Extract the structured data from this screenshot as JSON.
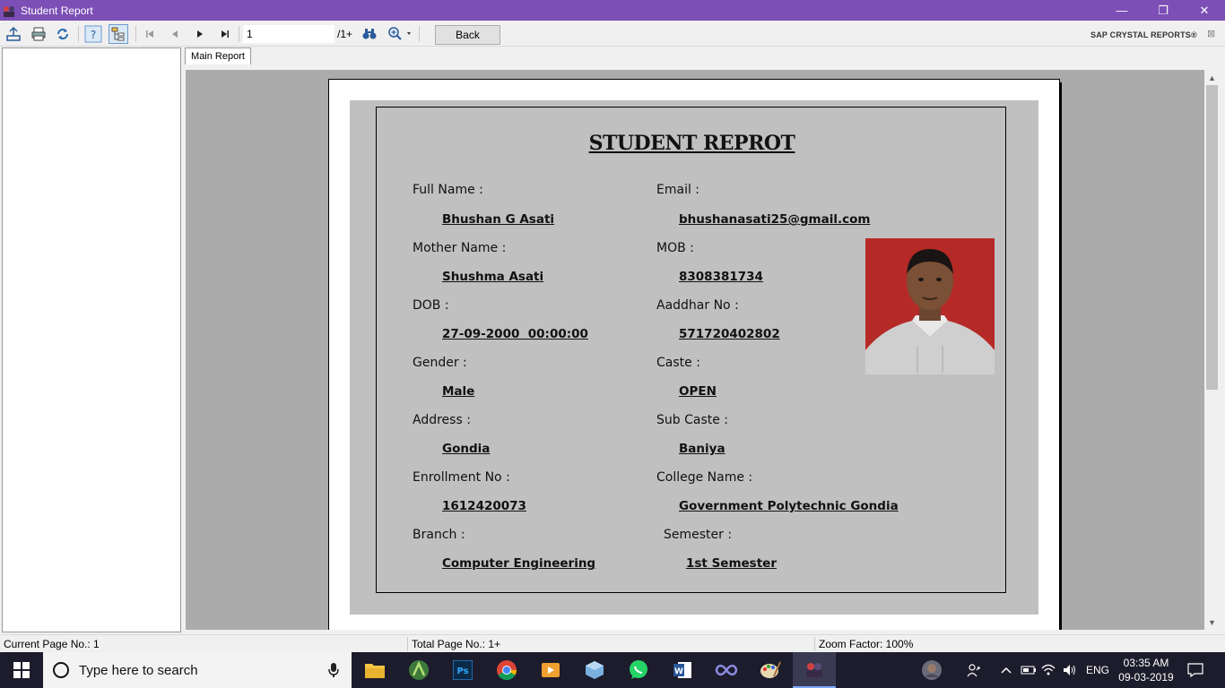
{
  "window": {
    "title": "Student Report",
    "controls": {
      "minimize": "—",
      "restore": "❐",
      "close": "✕"
    }
  },
  "toolbar": {
    "page_value": "1",
    "page_total": "/1+",
    "back_label": "Back",
    "brand": "SAP CRYSTAL REPORTS®",
    "brand_close": "⊠"
  },
  "tabs": {
    "main": "Main Report"
  },
  "report": {
    "title": "STUDENT REPROT",
    "fields": {
      "full_name_label": "Full Name :",
      "full_name": "Bhushan G Asati",
      "email_label": "Email :",
      "email": "bhushanasati25@gmail.com",
      "mother_label": "Mother Name :",
      "mother": "Shushma Asati",
      "mob_label": "MOB :",
      "mob": "8308381734",
      "dob_label": "DOB :",
      "dob": "27-09-2000  00:00:00",
      "aadhar_label": "Aaddhar No :",
      "aadhar": "571720402802",
      "gender_label": "Gender :",
      "gender": "Male",
      "caste_label": "Caste :",
      "caste": "OPEN",
      "address_label": "Address :",
      "address": "Gondia",
      "subcaste_label": "Sub Caste :",
      "subcaste": "Baniya",
      "enroll_label": "Enrollment No :",
      "enroll": "1612420073",
      "college_label": "College Name :",
      "college": "Government Polytechnic Gondia",
      "branch_label": "Branch :",
      "branch": "Computer Engineering",
      "semester_label": "Semester :",
      "semester": "1st Semester"
    }
  },
  "status": {
    "current_page": "Current Page No.: 1",
    "total_page": "Total Page No.: 1+",
    "zoom": "Zoom Factor: 100%"
  },
  "taskbar": {
    "search_placeholder": "Type here to search",
    "lang": "ENG",
    "time": "03:35 AM",
    "date": "09-03-2019"
  }
}
